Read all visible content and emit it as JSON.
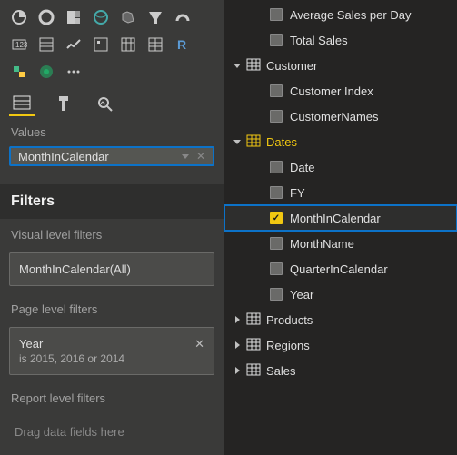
{
  "viz": {
    "tabs": [
      "fields-tab",
      "format-tab",
      "analytics-tab"
    ],
    "values_label": "Values",
    "well": {
      "field": "MonthInCalendar"
    }
  },
  "filters": {
    "header": "Filters",
    "groups": {
      "visual": {
        "label": "Visual level filters"
      },
      "page": {
        "label": "Page level filters"
      },
      "report": {
        "label": "Report level filters"
      }
    },
    "visual_card": {
      "title": "MonthInCalendar(All)"
    },
    "page_card": {
      "title": "Year",
      "sub": "is 2015, 2016 or 2014"
    },
    "drop_hint": "Drag data fields here"
  },
  "fields": {
    "top_orphans": [
      {
        "label": "Average Sales per Day"
      },
      {
        "label": "Total Sales"
      }
    ],
    "tables": [
      {
        "name": "Customer",
        "expanded": true,
        "highlight": false,
        "cols": [
          {
            "label": "Customer Index",
            "checked": false
          },
          {
            "label": "CustomerNames",
            "checked": false
          }
        ]
      },
      {
        "name": "Dates",
        "expanded": true,
        "highlight": true,
        "cols": [
          {
            "label": "Date",
            "checked": false
          },
          {
            "label": "FY",
            "checked": false
          },
          {
            "label": "MonthInCalendar",
            "checked": true,
            "selected": true
          },
          {
            "label": "MonthName",
            "checked": false
          },
          {
            "label": "QuarterInCalendar",
            "checked": false
          },
          {
            "label": "Year",
            "checked": false
          }
        ]
      },
      {
        "name": "Products",
        "expanded": false,
        "highlight": false
      },
      {
        "name": "Regions",
        "expanded": false,
        "highlight": false
      },
      {
        "name": "Sales",
        "expanded": false,
        "highlight": false
      }
    ]
  }
}
